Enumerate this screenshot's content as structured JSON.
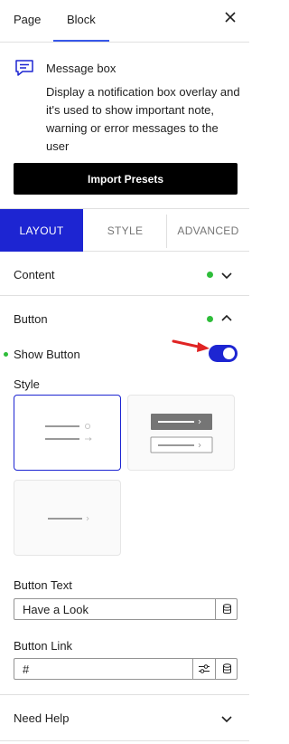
{
  "top_tabs": {
    "page": "Page",
    "block": "Block"
  },
  "block": {
    "title": "Message box",
    "description": "Display a notification box overlay and it's used to show important note, warning or error messages to the user"
  },
  "import_presets": "Import Presets",
  "tabs": {
    "layout": "LAYOUT",
    "style": "STYLE",
    "advanced": "ADVANCED"
  },
  "sections": {
    "content": "Content",
    "button": "Button",
    "need_help": "Need Help"
  },
  "button_settings": {
    "show_button_label": "Show Button",
    "show_button_on": true,
    "style_label": "Style",
    "button_text_label": "Button Text",
    "button_text_value": "Have a Look",
    "button_link_label": "Button Link",
    "button_link_value": "#"
  },
  "colors": {
    "accent": "#1d25d2",
    "status_green": "#2ebd3a",
    "annotation_arrow": "#e02424"
  },
  "icons": [
    "message-box-icon",
    "close-icon",
    "chevron-down-icon",
    "chevron-up-icon",
    "database-icon",
    "sliders-icon",
    "arrow-annotation"
  ]
}
